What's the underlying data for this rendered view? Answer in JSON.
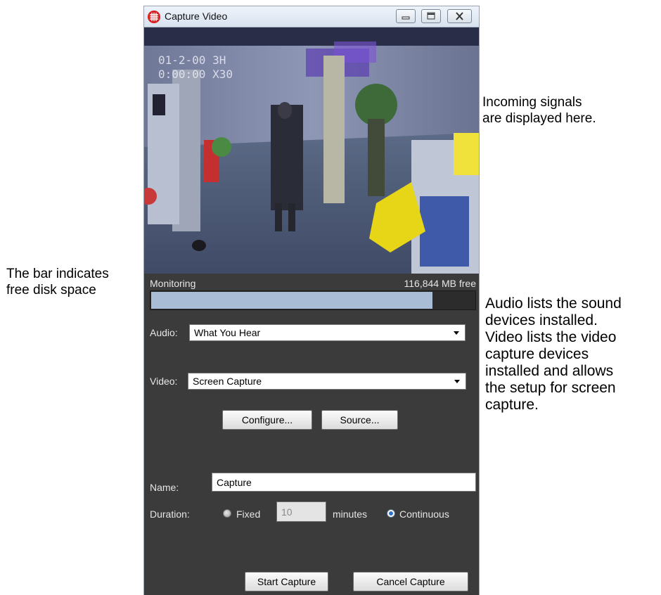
{
  "annotations": {
    "signals": "Incoming signals\nare displayed here.",
    "disk": "The bar indicates\nfree disk space",
    "audio_video": "Audio lists the sound\ndevices installed.\nVideo lists the video\ncapture devices\ninstalled and allows\nthe setup for screen\ncapture."
  },
  "window": {
    "title": "Capture Video"
  },
  "status": {
    "mode": "Monitoring",
    "disk_free": "116,844 MB free",
    "disk_bar_fraction": 0.87
  },
  "audio": {
    "label": "Audio:",
    "selected": "What You Hear"
  },
  "video": {
    "label": "Video:",
    "selected": "Screen Capture"
  },
  "buttons": {
    "configure": "Configure...",
    "source": "Source...",
    "start_capture": "Start Capture",
    "cancel_capture": "Cancel Capture"
  },
  "name": {
    "label": "Name:",
    "value": "Capture"
  },
  "duration": {
    "label": "Duration:",
    "fixed_label": "Fixed",
    "minutes_value": "10",
    "minutes_label": "minutes",
    "continuous_label": "Continuous",
    "selected": "continuous"
  },
  "preview_overlay": {
    "line1": "01-2-00  3H",
    "line2": "0:00:00  X30"
  },
  "colors": {
    "panel_background": "#3b3b3b",
    "disk_bar_fill": "#a9bdd6",
    "radio_selected": "#2d74c9"
  }
}
